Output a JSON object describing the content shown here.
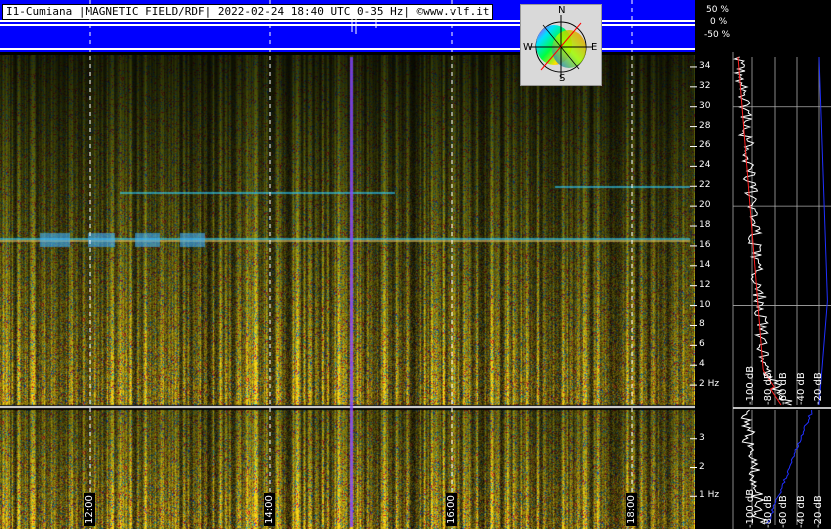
{
  "header": {
    "label": "I1-Cumiana |MAGNETIC FIELD/RDF| 2022-02-24 18:40 UTC 0-35 Hz| ©www.vlf.it"
  },
  "compass": {
    "north": "N",
    "south": "S",
    "east": "E",
    "west": "W"
  },
  "percent_scale": [
    "50 %",
    "0 %",
    "-50 %"
  ],
  "chart_data": [
    {
      "type": "heatmap",
      "title": "",
      "x": {
        "ticks": [
          "12:00",
          "14:00",
          "16:00",
          "18:00"
        ]
      },
      "y": {
        "range": [
          0,
          35
        ],
        "unit": "Hz",
        "ticks": [
          "2 Hz",
          "4",
          "6",
          "8",
          "10",
          "12",
          "14",
          "16",
          "18",
          "20",
          "22",
          "24",
          "26",
          "28",
          "30",
          "32",
          "34"
        ]
      },
      "spectrum_db_ticks": [
        "-100 dB",
        "-80 dB",
        "-60 dB",
        "-40 dB",
        "-20 dB"
      ],
      "grid": true
    },
    {
      "type": "heatmap",
      "title": "",
      "x": {
        "ticks": [
          "12:00",
          "14:00",
          "16:00",
          "18:00"
        ]
      },
      "y": {
        "range": [
          0,
          4
        ],
        "unit": "Hz",
        "ticks": [
          "1 Hz",
          "2",
          "3"
        ]
      },
      "spectrum_db_ticks": [
        "-100 dB",
        "-80 dB",
        "-60 dB",
        "-40 dB",
        "-20 dB"
      ],
      "grid": true
    }
  ],
  "colors": {
    "header_bar": "#0000ff",
    "background": "#000000",
    "spectrum_trace": "#ffffff",
    "spectrum_avg": "#ff2020",
    "spectrum_floor": "#2030ff"
  }
}
